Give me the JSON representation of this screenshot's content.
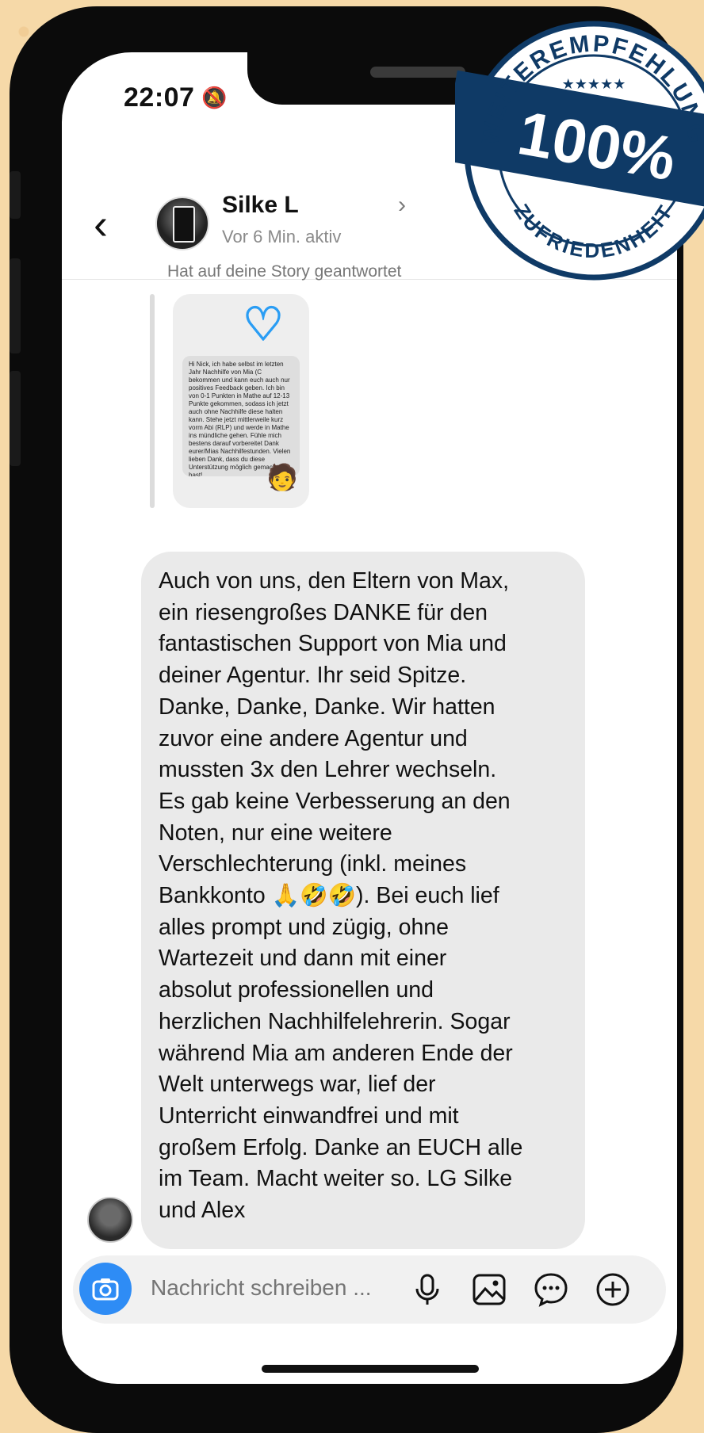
{
  "status_bar": {
    "time": "22:07"
  },
  "header": {
    "name": "Silke L",
    "status": "Vor 6 Min. aktiv"
  },
  "story": {
    "label": "Hat auf deine Story geantwortet",
    "text": "Hi Nick, ich habe selbst im letzten Jahr Nachhilfe von Mia (C bekommen und kann euch auch nur positives Feedback geben. Ich bin von 0-1 Punkten in Mathe auf 12-13 Punkte gekommen, sodass ich jetzt auch ohne Nachhilfe diese halten kann. Stehe jetzt mittlerweile kurz vorm Abi (RLP) und werde in Mathe ins mündliche gehen. Fühle mich bestens darauf vorbereitet Dank eurer/Mias Nachhilfestunden. Vielen lieben Dank, dass du diese Unterstützung möglich gemacht hast!"
  },
  "message": {
    "text": "Auch von uns, den Eltern von Max,\nein riesengroßes DANKE für den\nfantastischen Support von Mia und\ndeiner Agentur. Ihr seid Spitze.\nDanke, Danke, Danke. Wir hatten\nzuvor eine andere Agentur und\nmussten 3x den Lehrer wechseln.\nEs gab keine Verbesserung an den\nNoten, nur eine weitere\nVerschlechterung (inkl. meines\nBankkonto 🙏🤣🤣).  Bei euch lief\nalles prompt und zügig, ohne\nWartezeit und dann mit einer\nabsolut professionellen und\nherzlichen Nachhilfelehrerin. Sogar\nwährend Mia am anderen Ende der\nWelt unterwegs war, lief der\nUnterricht einwandfrei und mit\ngroßem Erfolg. Danke an EUCH alle\nim Team. Macht weiter so. LG Silke\nund Alex"
  },
  "composer": {
    "placeholder": "Nachricht schreiben ..."
  },
  "badge": {
    "top_text": "WEITEREMPFEHLUNG",
    "stars": "★★★★★",
    "percent": "100%",
    "bottom_text": "ZUFRIEDENHEIT",
    "color": "#0f3a66"
  },
  "icons": {
    "back": "chevron-left-icon",
    "camera": "camera-icon",
    "mic": "microphone-icon",
    "gallery": "image-icon",
    "sticker": "chat-bubble-icon",
    "add": "plus-circle-icon"
  }
}
